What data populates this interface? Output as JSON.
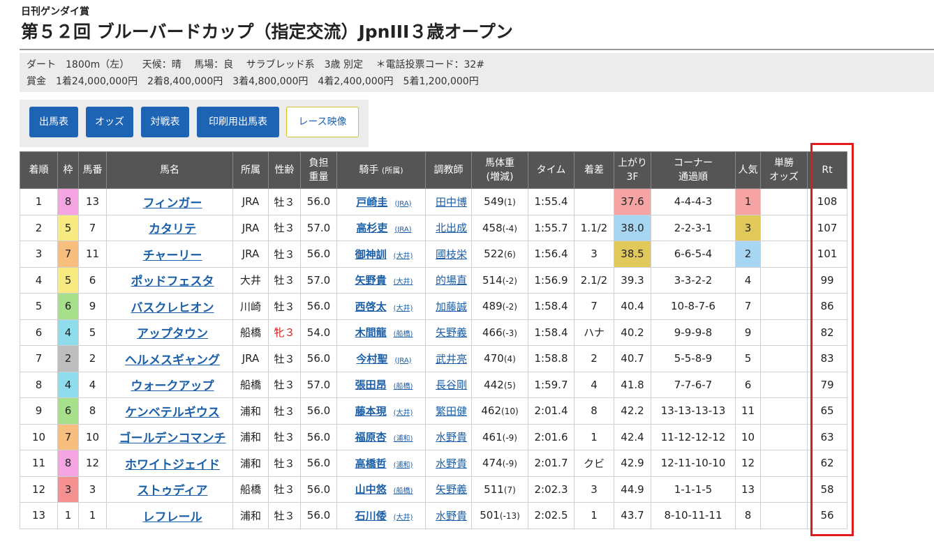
{
  "header": {
    "subtitle": "日刊ゲンダイ賞",
    "title": "第５２回 ブルーバードカップ（指定交流）JpnIII３歳オープン"
  },
  "info": {
    "line1": [
      "ダート　1800m（左）",
      "天候：晴",
      "馬場：良",
      "サラブレッド系　3歳 別定",
      "＊電話投票コード：32#"
    ],
    "line2": "賞金　1着24,000,000円　2着8,400,000円　3着4,800,000円　4着2,400,000円　5着1,200,000円"
  },
  "buttons": [
    "出馬表",
    "オッズ",
    "対戦表",
    "印刷用出馬表",
    "レース映像"
  ],
  "table": {
    "headers": [
      "着順",
      "枠",
      "馬番",
      "馬名",
      "所属",
      "性齢",
      "負担\n重量",
      "騎手",
      "(所属)",
      "調教師",
      "馬体重\n(増減)",
      "タイム",
      "着差",
      "上がり\n3F",
      "コーナー\n通過順",
      "人気",
      "単勝\nオッズ",
      "Rt"
    ],
    "rows": [
      {
        "pos": "1",
        "waku": "8",
        "num": "13",
        "horse": "フィンガー",
        "aff": "JRA",
        "sex": "牡３",
        "wt": "56.0",
        "jockey": "戸崎圭",
        "jaff": "(JRA)",
        "trainer": "田中博",
        "bw": "549",
        "bwd": "(1)",
        "time": "1:55.4",
        "margin": "",
        "last3f": "37.6",
        "corner": "4-4-4-3",
        "pop": "1",
        "odds": "",
        "rt": "108"
      },
      {
        "pos": "2",
        "waku": "5",
        "num": "7",
        "horse": "カタリテ",
        "aff": "JRA",
        "sex": "牡３",
        "wt": "57.0",
        "jockey": "高杉吏",
        "jaff": "(JRA)",
        "trainer": "北出成",
        "bw": "458",
        "bwd": "(-4)",
        "time": "1:55.7",
        "margin": "1.1/2",
        "last3f": "38.0",
        "corner": "2-2-3-1",
        "pop": "3",
        "odds": "",
        "rt": "107"
      },
      {
        "pos": "3",
        "waku": "7",
        "num": "11",
        "horse": "チャーリー",
        "aff": "JRA",
        "sex": "牡３",
        "wt": "56.0",
        "jockey": "御神訓",
        "jaff": "(大井)",
        "trainer": "國枝栄",
        "bw": "522",
        "bwd": "(6)",
        "time": "1:56.4",
        "margin": "3",
        "last3f": "38.5",
        "corner": "6-6-5-4",
        "pop": "2",
        "odds": "",
        "rt": "101"
      },
      {
        "pos": "4",
        "waku": "5",
        "num": "6",
        "horse": "ポッドフェスタ",
        "aff": "大井",
        "sex": "牡３",
        "wt": "57.0",
        "jockey": "矢野貴",
        "jaff": "(大井)",
        "trainer": "的場直",
        "bw": "514",
        "bwd": "(-2)",
        "time": "1:56.9",
        "margin": "2.1/2",
        "last3f": "39.3",
        "corner": "3-3-2-2",
        "pop": "4",
        "odds": "",
        "rt": "99"
      },
      {
        "pos": "5",
        "waku": "6",
        "num": "9",
        "horse": "バスクレヒオン",
        "aff": "川崎",
        "sex": "牡３",
        "wt": "56.0",
        "jockey": "西啓太",
        "jaff": "(大井)",
        "trainer": "加藤誠",
        "bw": "489",
        "bwd": "(-2)",
        "time": "1:58.4",
        "margin": "7",
        "last3f": "40.4",
        "corner": "10-8-7-6",
        "pop": "7",
        "odds": "",
        "rt": "86"
      },
      {
        "pos": "6",
        "waku": "4",
        "num": "5",
        "horse": "アップタウン",
        "aff": "船橋",
        "sex": "牝３",
        "wt": "54.0",
        "jockey": "木間龍",
        "jaff": "(船橋)",
        "trainer": "矢野義",
        "bw": "466",
        "bwd": "(-3)",
        "time": "1:58.4",
        "margin": "ハナ",
        "last3f": "40.2",
        "corner": "9-9-9-8",
        "pop": "9",
        "odds": "",
        "rt": "82"
      },
      {
        "pos": "7",
        "waku": "2",
        "num": "2",
        "horse": "ヘルメスギャング",
        "aff": "JRA",
        "sex": "牡３",
        "wt": "56.0",
        "jockey": "今村聖",
        "jaff": "(JRA)",
        "trainer": "武井亮",
        "bw": "470",
        "bwd": "(4)",
        "time": "1:58.8",
        "margin": "2",
        "last3f": "40.7",
        "corner": "5-5-8-9",
        "pop": "5",
        "odds": "",
        "rt": "83"
      },
      {
        "pos": "8",
        "waku": "4",
        "num": "4",
        "horse": "ウォークアップ",
        "aff": "船橋",
        "sex": "牡３",
        "wt": "57.0",
        "jockey": "張田昂",
        "jaff": "(船橋)",
        "trainer": "長谷剛",
        "bw": "442",
        "bwd": "(5)",
        "time": "1:59.7",
        "margin": "4",
        "last3f": "41.8",
        "corner": "7-7-6-7",
        "pop": "6",
        "odds": "",
        "rt": "79"
      },
      {
        "pos": "9",
        "waku": "6",
        "num": "8",
        "horse": "ケンベテルギウス",
        "aff": "浦和",
        "sex": "牡３",
        "wt": "56.0",
        "jockey": "藤本現",
        "jaff": "(大井)",
        "trainer": "繁田健",
        "bw": "462",
        "bwd": "(10)",
        "time": "2:01.4",
        "margin": "8",
        "last3f": "42.2",
        "corner": "13-13-13-13",
        "pop": "11",
        "odds": "",
        "rt": "65"
      },
      {
        "pos": "10",
        "waku": "7",
        "num": "10",
        "horse": "ゴールデンコマンチ",
        "aff": "浦和",
        "sex": "牡３",
        "wt": "56.0",
        "jockey": "福原杏",
        "jaff": "(浦和)",
        "trainer": "水野貴",
        "bw": "461",
        "bwd": "(-9)",
        "time": "2:01.6",
        "margin": "1",
        "last3f": "42.4",
        "corner": "11-12-12-12",
        "pop": "10",
        "odds": "",
        "rt": "63"
      },
      {
        "pos": "11",
        "waku": "8",
        "num": "12",
        "horse": "ホワイトジェイド",
        "aff": "浦和",
        "sex": "牡３",
        "wt": "56.0",
        "jockey": "高橋哲",
        "jaff": "(浦和)",
        "trainer": "水野貴",
        "bw": "474",
        "bwd": "(-9)",
        "time": "2:01.7",
        "margin": "クビ",
        "last3f": "42.9",
        "corner": "12-11-10-10",
        "pop": "12",
        "odds": "",
        "rt": "62"
      },
      {
        "pos": "12",
        "waku": "3",
        "num": "3",
        "horse": "ストゥディア",
        "aff": "船橋",
        "sex": "牡３",
        "wt": "56.0",
        "jockey": "山中悠",
        "jaff": "(船橋)",
        "trainer": "矢野義",
        "bw": "511",
        "bwd": "(7)",
        "time": "2:02.3",
        "margin": "3",
        "last3f": "44.9",
        "corner": "1-1-1-5",
        "pop": "13",
        "odds": "",
        "rt": "58"
      },
      {
        "pos": "13",
        "waku": "1",
        "num": "1",
        "horse": "レフレール",
        "aff": "浦和",
        "sex": "牡３",
        "wt": "56.0",
        "jockey": "石川倭",
        "jaff": "(大井)",
        "trainer": "水野貴",
        "bw": "501",
        "bwd": "(-13)",
        "time": "2:02.5",
        "margin": "1",
        "last3f": "43.7",
        "corner": "8-10-11-11",
        "pop": "8",
        "odds": "",
        "rt": "56"
      }
    ]
  },
  "colors": {
    "waku": {
      "1": "#ffffff",
      "2": "#bdbdbd",
      "3": "#f59090",
      "4": "#8fdcec",
      "5": "#f7ea80",
      "6": "#a6e08a",
      "7": "#f7be7e",
      "8": "#f5a4e2"
    },
    "rank1": "#f5a3a3",
    "rank2": "#a6d6f2",
    "rank3": "#e0c85a",
    "highlight_box": "#e11b1b"
  }
}
